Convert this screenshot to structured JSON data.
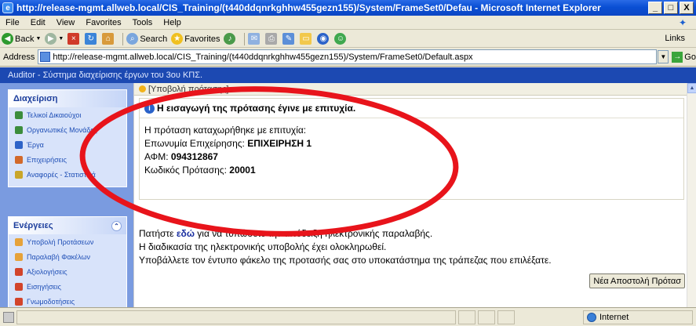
{
  "window": {
    "title": "http://release-mgmt.allweb.local/CIS_Training/(t440ddqnrkghhw455gezn155)/System/FrameSet0/Defau - Microsoft Internet Explorer",
    "controls": [
      "_",
      "□",
      "X"
    ]
  },
  "menu": [
    "File",
    "Edit",
    "View",
    "Favorites",
    "Tools",
    "Help"
  ],
  "toolbar": {
    "back": "Back",
    "search": "Search",
    "favorites": "Favorites",
    "links": "Links"
  },
  "address": {
    "label": "Address",
    "url": "http://release-mgmt.allweb.local/CIS_Training/(t440ddqnrkghhw455gezn155)/System/FrameSet0/Default.aspx",
    "go": "Go"
  },
  "app": {
    "header": "Auditor - Σύστημα διαχείρισης έργων του 3ου ΚΠΣ."
  },
  "sidebar": {
    "management": {
      "title": "Διαχείριση",
      "items": [
        {
          "label": "Τελικοί Δικαιούχοι"
        },
        {
          "label": "Οργανωτικές Μονάδες"
        },
        {
          "label": "Έργα"
        },
        {
          "label": "Επιχειρήσεις"
        },
        {
          "label": "Αναφορές - Στατιστικά"
        }
      ]
    },
    "actions": {
      "title": "Ενέργειες",
      "items": [
        {
          "label": "Υποβολή Προτάσεων"
        },
        {
          "label": "Παραλαβή Φακέλων"
        },
        {
          "label": "Αξιολογήσεις"
        },
        {
          "label": "Εισηγήσεις"
        },
        {
          "label": "Γνωμοδοτήσεις"
        }
      ]
    }
  },
  "content": {
    "section_title": "[Υποβολή πρότασης]",
    "success_title": "Η εισαγωγή της πρότασης έγινε με επιτυχία.",
    "lines": [
      {
        "label": "Η πρόταση καταχωρήθηκε με επιτυχία:",
        "value": ""
      },
      {
        "label": "Επωνυμία Επιχείρησης: ",
        "value": "ΕΠΙΧΕΙΡΗΣΗ 1"
      },
      {
        "label": "ΑΦΜ: ",
        "value": "094312867"
      },
      {
        "label": "Κωδικός Πρότασης: ",
        "value": "20001"
      }
    ],
    "instr1_pre": "Πατήστε ",
    "instr1_link": "εδώ",
    "instr1_post": " για να τυπώσετε την απόδειξη ηλεκτρονικής παραλαβής.",
    "instr2": "Η διαδικασία της ηλεκτρονικής υποβολής έχει ολοκληρωθεί.",
    "instr3": "Υποβάλλετε τον έντυπο φάκελο της προτασής σας στο υποκατάστημα της τράπεζας που επιλέξατε.",
    "new_button": "Νέα Αποστολή Πρότασ"
  },
  "status": {
    "zone": "Internet"
  },
  "colors": {
    "annotation": "#e8141b",
    "app_header": "#1c49b2",
    "sidebar_bg": "#7a9be0"
  }
}
